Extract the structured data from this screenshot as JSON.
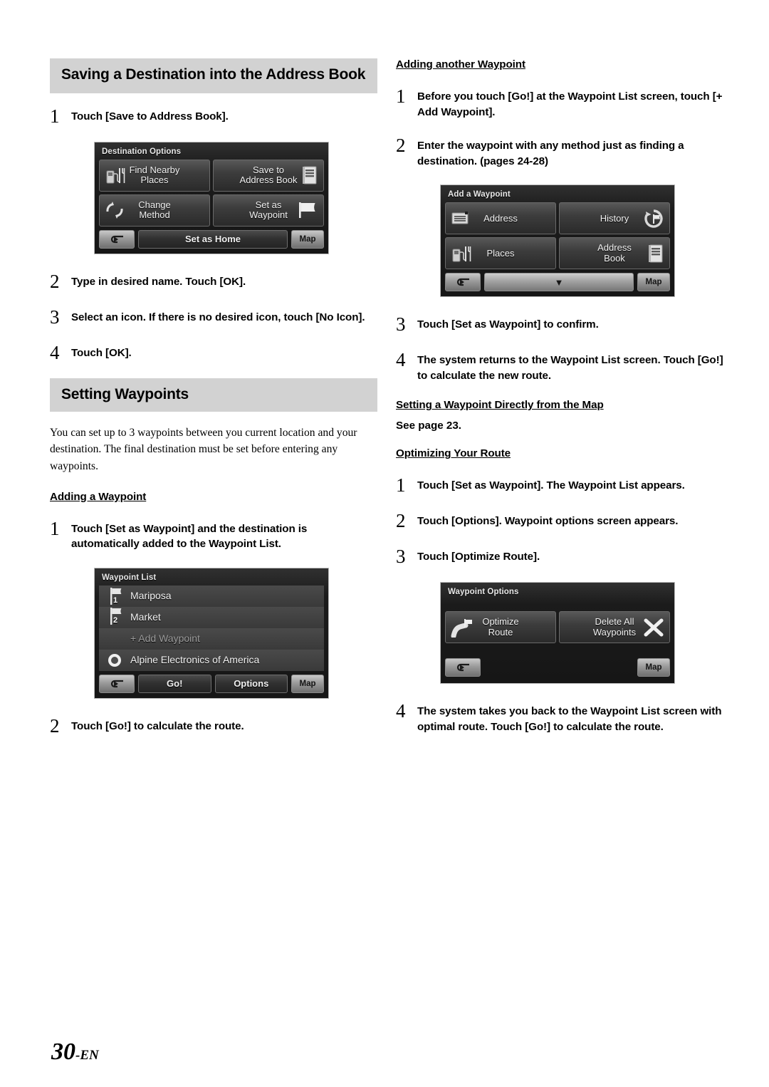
{
  "page": {
    "footer_number": "30",
    "footer_suffix": "-EN"
  },
  "left_column": {
    "section1": {
      "heading": "Saving a Destination into the Address Book",
      "steps": [
        {
          "num": "1",
          "html": "Touch <b>[Save to Address Book]</b>."
        },
        {
          "num": "2",
          "html": "Type in desired name. Touch <b>[OK]</b>."
        },
        {
          "num": "3",
          "html": "Select an icon. If there is no desired icon, touch <b>[No Icon]</b>."
        },
        {
          "num": "4",
          "html": "Touch <b>[OK]</b>."
        }
      ]
    },
    "destination_options_screen": {
      "title": "Destination Options",
      "buttons": [
        {
          "label_line1": "Find Nearby",
          "label_line2": "Places",
          "icon": "gas-pump-fork-knife-icon",
          "icon_side": "left"
        },
        {
          "label_line1": "Save to",
          "label_line2": "Address Book",
          "icon": "address-book-icon",
          "icon_side": "right"
        },
        {
          "label_line1": "Change",
          "label_line2": "Method",
          "icon": "two-arrows-icon",
          "icon_side": "left"
        },
        {
          "label_line1": "Set as",
          "label_line2": "Waypoint",
          "icon": "flag-icon",
          "icon_side": "right"
        }
      ],
      "bottom": {
        "back_label": "",
        "center_label": "Set as Home",
        "map_label": "Map"
      }
    },
    "section2": {
      "heading": "Setting Waypoints",
      "intro": "You can set up to 3 waypoints between you current location and your destination. The final destination must be set before entering any waypoints.",
      "subheading": "Adding a Waypoint",
      "steps": [
        {
          "num": "1",
          "html": "Touch <b>[Set as Waypoint]</b> and the destination is automatically added to the Waypoint List."
        },
        {
          "num": "2",
          "html": "Touch <b>[Go!]</b> to calculate the route."
        }
      ]
    },
    "waypoint_list_screen": {
      "title": "Waypoint List",
      "rows": [
        {
          "text": "Mariposa",
          "marker": "flag-1",
          "dim": false
        },
        {
          "text": "Market",
          "marker": "flag-2",
          "dim": false
        },
        {
          "text": "+ Add Waypoint",
          "marker": "none",
          "dim": true
        },
        {
          "text": "Alpine Electronics of America",
          "marker": "destination-dot",
          "dim": false
        }
      ],
      "bottom": {
        "back_label": "",
        "go_label": "Go!",
        "options_label": "Options",
        "map_label": "Map"
      }
    }
  },
  "right_column": {
    "subheading1": "Adding another Waypoint",
    "steps1": [
      {
        "num": "1",
        "html": "Before you touch <b>[Go!]</b> at the Waypoint List screen, touch [+ <b>Add Waypoint</b>]."
      },
      {
        "num": "2",
        "html": "Enter the waypoint with any method just as finding a destination. (pages 24-28)"
      }
    ],
    "add_waypoint_screen": {
      "title": "Add a Waypoint",
      "buttons": [
        {
          "label_line1": "Address",
          "label_line2": "",
          "icon": "address-card-icon",
          "icon_side": "left"
        },
        {
          "label_line1": "History",
          "label_line2": "",
          "icon": "history-flag-icon",
          "icon_side": "right"
        },
        {
          "label_line1": "Places",
          "label_line2": "",
          "icon": "gas-pump-fork-knife-icon",
          "icon_side": "left"
        },
        {
          "label_line1": "Address",
          "label_line2": "Book",
          "icon": "address-book-icon",
          "icon_side": "right"
        }
      ],
      "bottom": {
        "back_label": "",
        "center_label": "▼",
        "map_label": "Map"
      }
    },
    "steps2": [
      {
        "num": "3",
        "html": "Touch <b>[Set as Waypoint]</b> to confirm."
      },
      {
        "num": "4",
        "html": "The system returns to the Waypoint List screen. Touch <b>[Go!]</b> to calculate the new route."
      }
    ],
    "subheading2": "Setting a Waypoint Directly from the Map",
    "see_page": "See page 23.",
    "subheading3": "Optimizing Your Route",
    "steps3": [
      {
        "num": "1",
        "html": "Touch <b>[Set as Waypoint]</b>. The Waypoint List appears."
      },
      {
        "num": "2",
        "html": "Touch <b>[Options]</b>. Waypoint options screen appears."
      },
      {
        "num": "3",
        "html": "Touch <b>[Optimize Route]</b>."
      }
    ],
    "waypoint_options_screen": {
      "title": "Waypoint Options",
      "buttons": [
        {
          "label_line1": "Optimize",
          "label_line2": "Route",
          "icon": "road-flag-icon",
          "icon_side": "left"
        },
        {
          "label_line1": "Delete All",
          "label_line2": "Waypoints",
          "icon": "x-cross-icon",
          "icon_side": "right"
        }
      ],
      "bottom": {
        "back_label": "",
        "map_label": "Map"
      }
    },
    "steps4": [
      {
        "num": "4",
        "html": "The system takes you back to the Waypoint List screen with optimal route. Touch <b>[Go!]</b> to calculate the route."
      }
    ]
  },
  "colors": {
    "section_bar_bg": "#d2d2d2",
    "device_bg": "#1d1d1d",
    "text": "#000000"
  }
}
